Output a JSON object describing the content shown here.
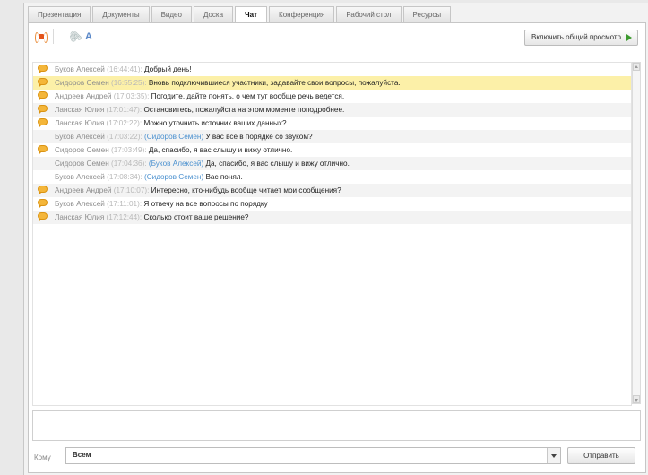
{
  "tabs": [
    {
      "label": "Презентация"
    },
    {
      "label": "Документы"
    },
    {
      "label": "Видео"
    },
    {
      "label": "Доска"
    },
    {
      "label": "Чат",
      "active": true
    },
    {
      "label": "Конференция"
    },
    {
      "label": "Рабочий стол"
    },
    {
      "label": "Ресурсы"
    }
  ],
  "toolbar": {
    "share_label": "Включить общий просмотр",
    "icons": [
      "sound-icon",
      "attach-icon",
      "font-icon"
    ]
  },
  "messages": [
    {
      "author": "Буков Алексей",
      "time": "(16:44:41):",
      "mention": "",
      "text": "Добрый день!",
      "icon": true,
      "style": ""
    },
    {
      "author": "Сидоров Семен",
      "time": "(16:55:25):",
      "mention": "",
      "text": "Вновь подключившиеся участники, задавайте свои вопросы, пожалуйста.",
      "icon": true,
      "style": "hl"
    },
    {
      "author": "Андреев Андрей",
      "time": "(17:03:35):",
      "mention": "",
      "text": "Погодите, дайте понять, о чем тут вообще речь ведется.",
      "icon": true,
      "style": ""
    },
    {
      "author": "Ланская Юлия",
      "time": "(17:01:47):",
      "mention": "",
      "text": "Остановитесь, пожалуйста на этом моменте поподробнее.",
      "icon": true,
      "style": "alt"
    },
    {
      "author": "Ланская Юлия",
      "time": "(17:02:22):",
      "mention": "",
      "text": "Можно уточнить источник ваших данных?",
      "icon": true,
      "style": ""
    },
    {
      "author": "Буков Алексей",
      "time": "(17:03:22):",
      "mention": "(Сидоров Семен)",
      "text": "У вас всё в порядке со звуком?",
      "icon": false,
      "style": "alt"
    },
    {
      "author": "Сидоров Семен",
      "time": "(17:03:49):",
      "mention": "",
      "text": "Да, спасибо, я вас слышу и вижу отлично.",
      "icon": true,
      "style": ""
    },
    {
      "author": "Сидоров Семен",
      "time": "(17:04:36):",
      "mention": "(Буков Алексей)",
      "text": "Да, спасибо, я вас слышу и вижу отлично.",
      "icon": false,
      "style": "alt"
    },
    {
      "author": "Буков Алексей",
      "time": "(17:08:34):",
      "mention": "(Сидоров Семен)",
      "text": "Вас понял.",
      "icon": false,
      "style": ""
    },
    {
      "author": "Андреев Андрей",
      "time": "(17:10:07):",
      "mention": "",
      "text": "Интересно, кто-нибудь вообще читает мои сообщения?",
      "icon": true,
      "style": "alt"
    },
    {
      "author": "Буков Алексей",
      "time": "(17:11:01):",
      "mention": "",
      "text": "Я отвечу на все вопросы по порядку",
      "icon": true,
      "style": ""
    },
    {
      "author": "Ланская Юлия",
      "time": "(17:12:44):",
      "mention": "",
      "text": "Сколько стоит ваше решение?",
      "icon": true,
      "style": "alt"
    }
  ],
  "compose": {
    "to_label": "Кому",
    "recipient": "Всем",
    "send_label": "Отправить"
  }
}
